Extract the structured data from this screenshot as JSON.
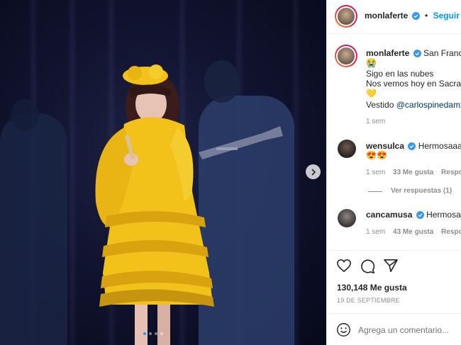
{
  "post": {
    "username": "monlaferte",
    "follow_label": "Seguir",
    "caption_location": "San Francisco",
    "caption_emoji_1": "😭",
    "caption_line_1": "Sigo en las nubes",
    "caption_line_2": "Nos vemos hoy en Sacramento",
    "caption_emoji_2": "💛",
    "caption_prefix": "Vestido",
    "caption_mention": "@carlospinedamx",
    "caption_time": "1 sem"
  },
  "comments": [
    {
      "username": "wensulca",
      "text": "Hermosaaaaa",
      "emoji": "😍😍",
      "time": "1 sem",
      "likes": "33 Me gusta",
      "reply": "Responder",
      "view_replies": "Ver respuestas (1)"
    },
    {
      "username": "cancamusa",
      "text": "Hermosa💛",
      "time": "1 sem",
      "likes": "43 Me gusta",
      "reply": "Responder"
    }
  ],
  "stats": {
    "likes": "130,148 Me gusta",
    "date": "19 DE SEPTIEMBRE"
  },
  "composer": {
    "placeholder": "Agrega un comentario..."
  },
  "carousel": {
    "slide_count": 4,
    "active_slide": 1
  },
  "colors": {
    "accent": "#0095f6",
    "verified": "#3897f0",
    "dress": "#f2c21b"
  }
}
